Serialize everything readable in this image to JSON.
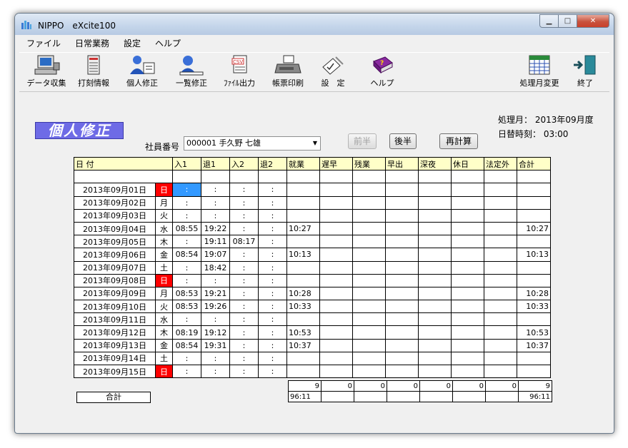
{
  "window": {
    "title": "NIPPO　eXcite100"
  },
  "menu": [
    "ファイル",
    "日常業務",
    "設定",
    "ヘルプ"
  ],
  "toolbar": {
    "data_collect": "データ収集",
    "stamp_info": "打刻情報",
    "personal_edit": "個人修正",
    "list_edit": "一覧修正",
    "file_output": "ﾌｧｲﾙ出力",
    "form_print": "帳票印刷",
    "settings": "設　定",
    "help": "ヘルプ",
    "month_change": "処理月変更",
    "exit": "終了"
  },
  "page": {
    "title": "個人修正",
    "employee_label": "社員番号",
    "employee_value": "000001 手久野 七雄",
    "prev_half": "前半",
    "next_half": "後半",
    "recalc": "再計算",
    "processing_month": "処理月：  2013年09月度",
    "date_switch_time": "日替時刻：  03:00"
  },
  "table": {
    "headers": [
      "日 付",
      "入1",
      "退1",
      "入2",
      "退2",
      "就業",
      "遅早",
      "残業",
      "早出",
      "深夜",
      "休日",
      "法定外",
      "合計"
    ],
    "rows": [
      {
        "date": "2013年09月01日",
        "dow": "日",
        "in1": ":",
        "out1": ":",
        "in2": ":",
        "out2": ":",
        "work": "",
        "total": ""
      },
      {
        "date": "2013年09月02日",
        "dow": "月",
        "in1": ":",
        "out1": ":",
        "in2": ":",
        "out2": ":",
        "work": "",
        "total": ""
      },
      {
        "date": "2013年09月03日",
        "dow": "火",
        "in1": ":",
        "out1": ":",
        "in2": ":",
        "out2": ":",
        "work": "",
        "total": ""
      },
      {
        "date": "2013年09月04日",
        "dow": "水",
        "in1": "08:55",
        "out1": "19:22",
        "in2": ":",
        "out2": ":",
        "work": "10:27",
        "total": "10:27"
      },
      {
        "date": "2013年09月05日",
        "dow": "木",
        "in1": ":",
        "out1": "19:11",
        "in2": "08:17",
        "out2": ":",
        "work": "",
        "total": ""
      },
      {
        "date": "2013年09月06日",
        "dow": "金",
        "in1": "08:54",
        "out1": "19:07",
        "in2": ":",
        "out2": ":",
        "work": "10:13",
        "total": "10:13"
      },
      {
        "date": "2013年09月07日",
        "dow": "土",
        "in1": ":",
        "out1": "18:42",
        "in2": ":",
        "out2": ":",
        "work": "",
        "total": ""
      },
      {
        "date": "2013年09月08日",
        "dow": "日",
        "in1": ":",
        "out1": ":",
        "in2": ":",
        "out2": ":",
        "work": "",
        "total": ""
      },
      {
        "date": "2013年09月09日",
        "dow": "月",
        "in1": "08:53",
        "out1": "19:21",
        "in2": ":",
        "out2": ":",
        "work": "10:28",
        "total": "10:28"
      },
      {
        "date": "2013年09月10日",
        "dow": "火",
        "in1": "08:53",
        "out1": "19:26",
        "in2": ":",
        "out2": ":",
        "work": "10:33",
        "total": "10:33"
      },
      {
        "date": "2013年09月11日",
        "dow": "水",
        "in1": ":",
        "out1": ":",
        "in2": ":",
        "out2": ":",
        "work": "",
        "total": ""
      },
      {
        "date": "2013年09月12日",
        "dow": "木",
        "in1": "08:19",
        "out1": "19:12",
        "in2": ":",
        "out2": ":",
        "work": "10:53",
        "total": "10:53"
      },
      {
        "date": "2013年09月13日",
        "dow": "金",
        "in1": "08:54",
        "out1": "19:31",
        "in2": ":",
        "out2": ":",
        "work": "10:37",
        "total": "10:37"
      },
      {
        "date": "2013年09月14日",
        "dow": "土",
        "in1": ":",
        "out1": ":",
        "in2": ":",
        "out2": ":",
        "work": "",
        "total": ""
      },
      {
        "date": "2013年09月15日",
        "dow": "日",
        "in1": ":",
        "out1": ":",
        "in2": ":",
        "out2": ":",
        "work": "",
        "total": ""
      }
    ]
  },
  "totals": {
    "label": "合計",
    "counts": [
      "9",
      "0",
      "0",
      "0",
      "0",
      "0",
      "0",
      "9"
    ],
    "times": [
      "96:11",
      "",
      "",
      "",
      "",
      "",
      "",
      "96:11"
    ]
  },
  "colors": {
    "sunday": "#ff0000",
    "header": "#ffffc8",
    "banner": "#6e6be6",
    "selection": "#3399ff"
  }
}
